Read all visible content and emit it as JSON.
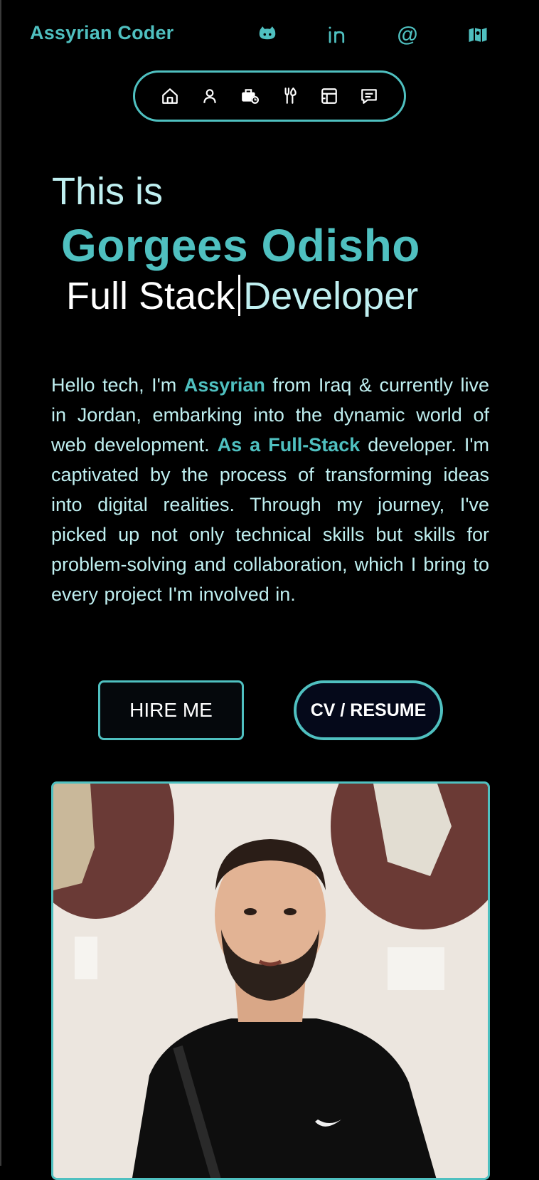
{
  "header": {
    "brand": "Assyrian Coder",
    "social_icons": [
      "github-icon",
      "linkedin-icon",
      "at-sign-icon",
      "map-icon"
    ],
    "at_glyph": "@"
  },
  "nav": {
    "items": [
      "home-icon",
      "user-icon",
      "briefcase-icon",
      "tools-icon",
      "projects-icon",
      "message-icon"
    ]
  },
  "hero": {
    "intro": "This is",
    "name": "Gorgees Odisho",
    "role_typed": "Full Stack",
    "role_rest": "Developer"
  },
  "about": {
    "p1": "Hello tech, I'm ",
    "hl1": "Assyrian",
    "p2": " from Iraq & currently live in Jordan, embarking into the dynamic world of web development. ",
    "hl2": "As a Full-Stack",
    "p3": " developer. I'm captivated by the process of transforming ideas into digital realities. Through my journey, I've picked up not only technical skills but skills for problem-solving and collaboration, which I bring to every project I'm involved in."
  },
  "actions": {
    "hire": "HIRE ME",
    "cv": "CV / RESUME"
  },
  "colors": {
    "accent": "#4fc0c0",
    "text_light": "#bfeff0",
    "background": "#000000"
  }
}
